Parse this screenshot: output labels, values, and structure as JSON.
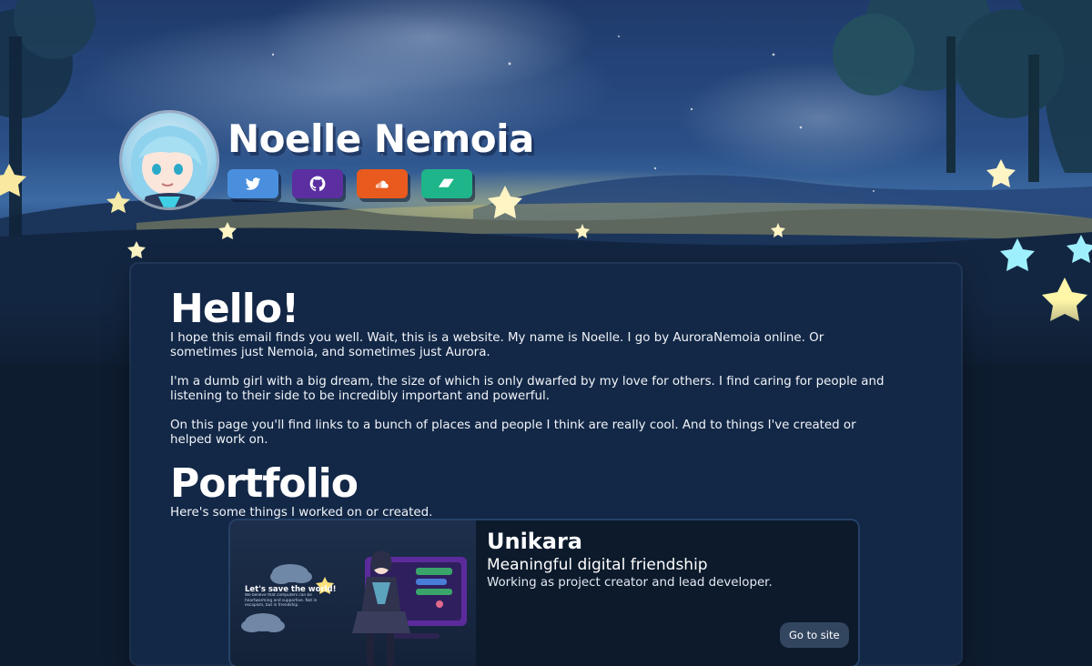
{
  "header": {
    "name": "Noelle Nemoia",
    "socials": [
      {
        "id": "twitter",
        "icon": "twitter-bird-icon",
        "color": "#4a8fde"
      },
      {
        "id": "github",
        "icon": "github-octocat-icon",
        "color": "#5b2fa0"
      },
      {
        "id": "soundcloud",
        "icon": "soundcloud-icon",
        "color": "#e85a1d"
      },
      {
        "id": "feedback",
        "icon": "parallelogram-icon",
        "color": "#1fb58a"
      }
    ]
  },
  "hello": {
    "heading": "Hello!",
    "paragraphs": [
      "I hope this email finds you well. Wait, this is a website. My name is Noelle. I go by AuroraNemoia online. Or sometimes just Nemoia, and sometimes just Aurora.",
      "I'm a dumb girl with a big dream, the size of which is only dwarfed by my love for others. I find caring for people and listening to their side to be incredibly important and powerful.",
      "On this page you'll find links to a bunch of places and people I think are really cool. And to things I've created or helped work on."
    ]
  },
  "portfolio": {
    "heading": "Portfolio",
    "intro": "Here's some things I worked on or created.",
    "projects": [
      {
        "title": "Unikara",
        "subtitle": "Meaningful digital friendship",
        "role": "Working as project creator and lead developer.",
        "button": "Go to site",
        "preview_heading": "Let's save the world!",
        "preview_text": "We believe that computers can be heartwarming and supportive. Not in escapism, but in friendship."
      }
    ]
  }
}
